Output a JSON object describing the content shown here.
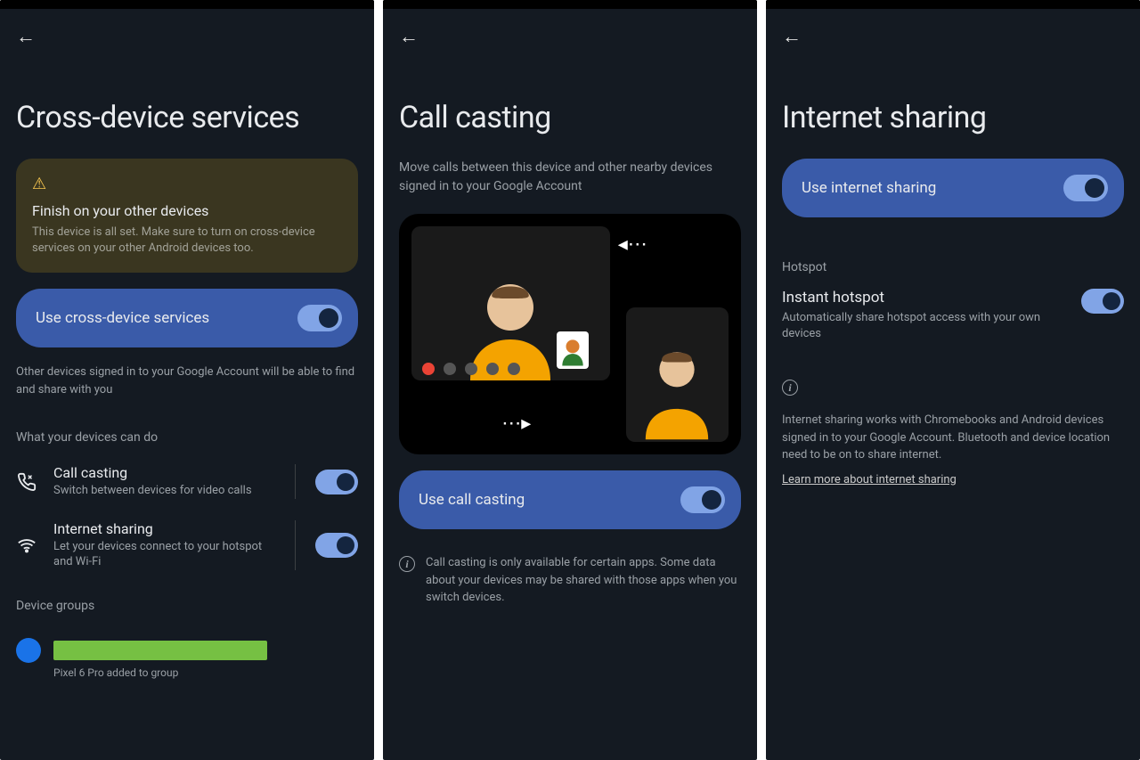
{
  "screens": {
    "cross": {
      "title": "Cross-device services",
      "warn": {
        "title": "Finish on your other devices",
        "body": "This device is all set. Make sure to turn on cross-device services on your other Android devices too."
      },
      "primary_toggle": "Use cross-device services",
      "helper": "Other devices signed in to your Google Account will be able to find and share with you",
      "section_features": "What your devices can do",
      "features": [
        {
          "title": "Call casting",
          "sub": "Switch between devices for video calls"
        },
        {
          "title": "Internet sharing",
          "sub": "Let your devices connect to your hotspot and Wi-Fi"
        }
      ],
      "section_groups": "Device groups",
      "group_caption": "Pixel 6 Pro added to group"
    },
    "call": {
      "title": "Call casting",
      "subtitle": "Move calls between this device and other nearby devices signed in to your Google Account",
      "primary_toggle": "Use call casting",
      "info": "Call casting is only available for certain apps. Some data about your devices may be shared with those apps when you switch devices."
    },
    "internet": {
      "title": "Internet sharing",
      "primary_toggle": "Use internet sharing",
      "section_hotspot": "Hotspot",
      "hotspot": {
        "title": "Instant hotspot",
        "sub": "Automatically share hotspot access with your own devices"
      },
      "info": "Internet sharing works with Chromebooks and Android devices signed in to your Google Account. Bluetooth and device location need to be on to share internet.",
      "link": "Learn more about internet sharing"
    }
  }
}
